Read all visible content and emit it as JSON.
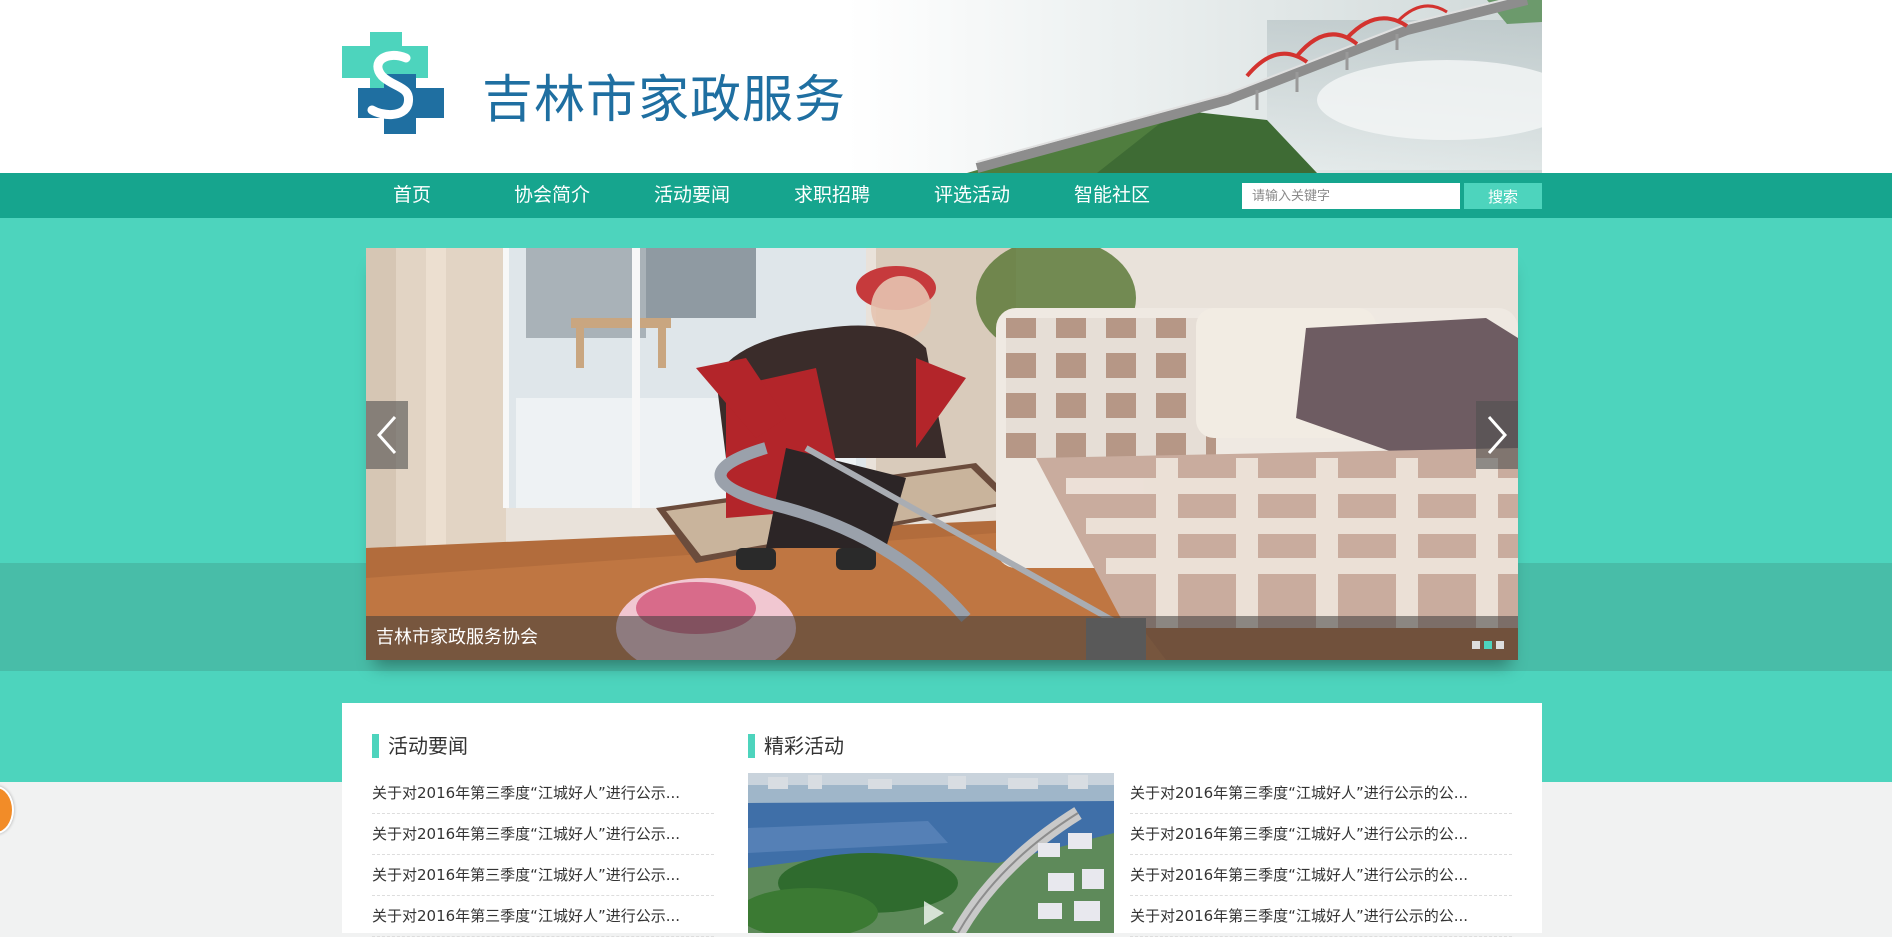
{
  "header": {
    "site_title": "吉林市家政服务协会"
  },
  "nav": {
    "items": [
      "首页",
      "协会简介",
      "活动要闻",
      "求职招聘",
      "评选活动",
      "智能社区"
    ],
    "search_placeholder": "请输入关键字",
    "search_button": "搜索"
  },
  "slider": {
    "caption": "吉林市家政服务协会",
    "slide_count": 3,
    "active_slide": 2
  },
  "news": {
    "title": "活动要闻",
    "items": [
      "关于对2016年第三季度“江城好人”进行公示...",
      "关于对2016年第三季度“江城好人”进行公示...",
      "关于对2016年第三季度“江城好人”进行公示...",
      "关于对2016年第三季度“江城好人”进行公示..."
    ]
  },
  "activities": {
    "title": "精彩活动",
    "items": [
      "关于对2016年第三季度“江城好人”进行公示的公...",
      "关于对2016年第三季度“江城好人”进行公示的公...",
      "关于对2016年第三季度“江城好人”进行公示的公...",
      "关于对2016年第三季度“江城好人”进行公示的公..."
    ]
  },
  "colors": {
    "nav_bg": "#16a58e",
    "accent": "#4dd4bd",
    "title_blue": "#1f6fa1"
  }
}
